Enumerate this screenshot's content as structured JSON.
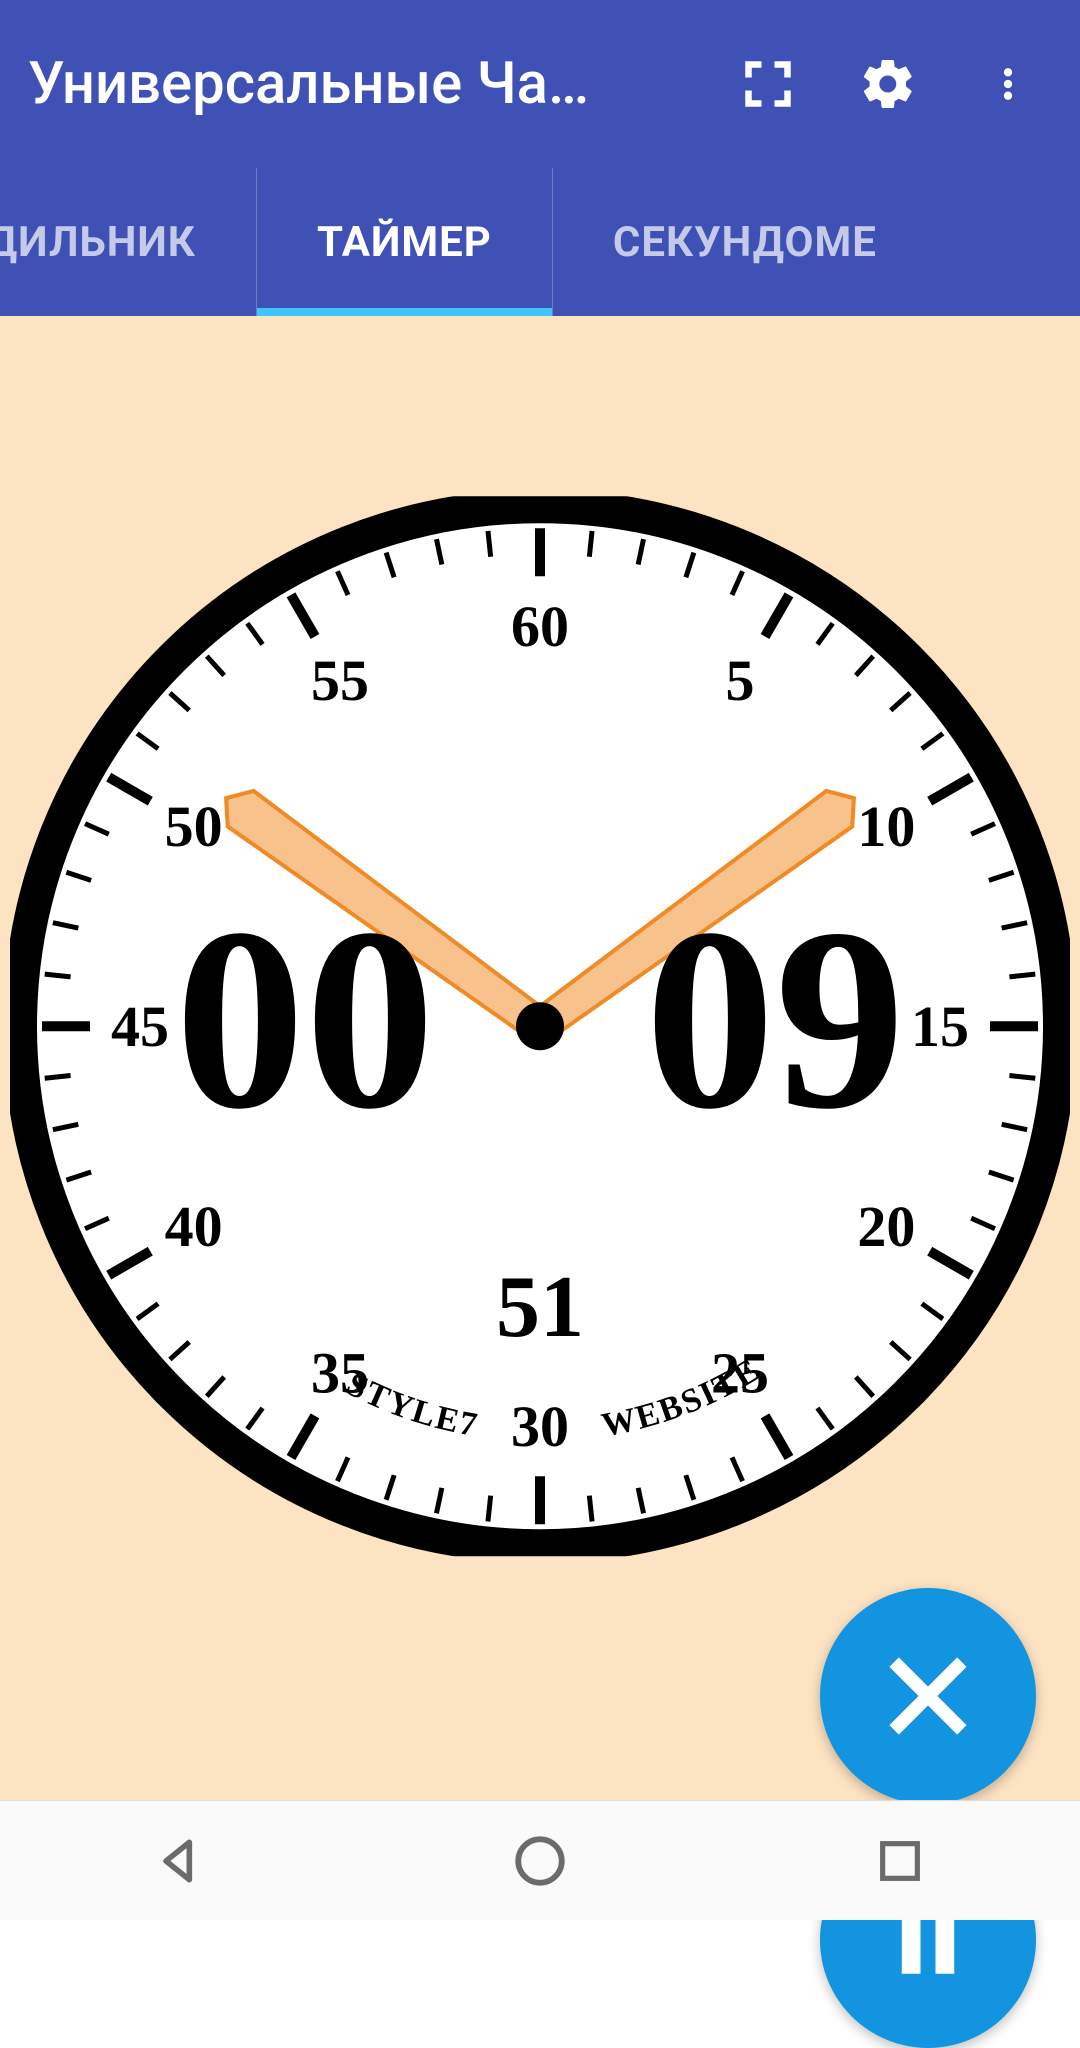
{
  "colors": {
    "primary": "#3f51b5",
    "accent": "#1394e0",
    "tab_indicator": "#40c4ff",
    "timer_bg": "#fce3c2",
    "hand": "#f7c28c",
    "hand_stroke": "#f08a24"
  },
  "appbar": {
    "title": "Универсальные Ча…"
  },
  "tabs": {
    "items": [
      {
        "label": "УДИЛЬНИК",
        "active": false
      },
      {
        "label": "ТАЙМЕР",
        "active": true
      },
      {
        "label": "СЕКУНДОМЕ",
        "active": false
      }
    ]
  },
  "timer": {
    "display_minutes": "00",
    "display_seconds": "09",
    "sub_seconds": "51",
    "brand_left": "STYLE7",
    "brand_right": "WEBSITE",
    "dial_numbers": [
      "60",
      "5",
      "10",
      "15",
      "20",
      "25",
      "30",
      "35",
      "40",
      "45",
      "50",
      "55"
    ],
    "minute_hand_value": 51,
    "second_hand_value": 9
  }
}
